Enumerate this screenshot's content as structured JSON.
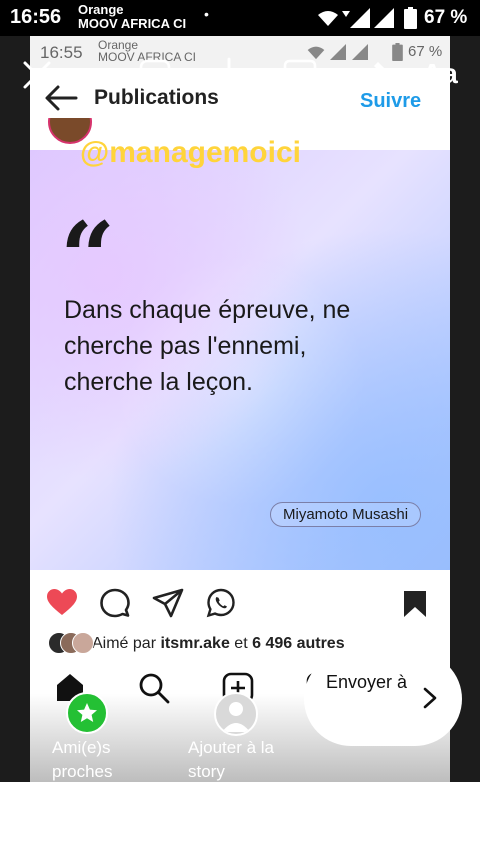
{
  "outer_status": {
    "time": "16:56",
    "carrier_line1": "Orange",
    "carrier_line2": "MOOV AFRICA CI",
    "dot": "•",
    "battery": "67 %"
  },
  "inner_status": {
    "time": "16:55",
    "carrier_line1": "Orange",
    "carrier_line2": "MOOV AFRICA CI",
    "battery": "67 %"
  },
  "story_tools": {
    "text_tool": "Aa"
  },
  "mention": "@managemoici",
  "header": {
    "title": "Publications",
    "follow": "Suivre"
  },
  "post": {
    "quote_mark": "“",
    "quote_lines": [
      "Dans chaque épreuve, ne",
      "cherche pas l'ennemi,",
      "cherche la leçon."
    ],
    "author": "Miyamoto Musashi"
  },
  "likes": {
    "prefix": "Aimé par ",
    "user": "itsmr.ake",
    "middle": " et ",
    "count": "6 496 autres"
  },
  "story_bottom": {
    "close_friends": "Ami(e)s proches",
    "add_story": "Ajouter à la story",
    "send_to": "Envoyer à"
  },
  "colors": {
    "like": "#ed4956",
    "follow": "#1e9be8",
    "mention": "#ffd43b",
    "close_friends": "#24c034"
  }
}
